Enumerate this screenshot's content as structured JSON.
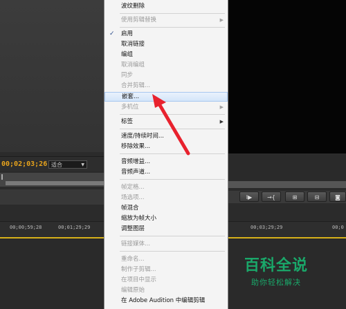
{
  "editor": {
    "timecode": "00;02;03;26",
    "fit_select": "适合",
    "ruler_left": [
      "00;00;59;28",
      "00;01;29;29"
    ],
    "ruler_right": [
      "00;03;29;29",
      "00;0"
    ],
    "buttons": [
      "I▶",
      "→{",
      "⊞",
      "⊟",
      "◙"
    ]
  },
  "menu": {
    "items": [
      {
        "label": "波纹删除",
        "disabled": false
      },
      {
        "label": "使用剪辑替换",
        "disabled": true,
        "submenu": true
      },
      {
        "label": "启用",
        "disabled": false,
        "checked": true
      },
      {
        "label": "取消链接",
        "disabled": false
      },
      {
        "label": "编组",
        "disabled": false
      },
      {
        "label": "取消编组",
        "disabled": true
      },
      {
        "label": "同步",
        "disabled": true
      },
      {
        "label": "合并剪辑...",
        "disabled": true
      },
      {
        "label": "嵌套...",
        "disabled": false,
        "highlighted": true
      },
      {
        "label": "多机位",
        "disabled": true,
        "submenu": true
      },
      {
        "label": "标签",
        "disabled": false,
        "submenu": true
      },
      {
        "label": "速度/持续时间...",
        "disabled": false
      },
      {
        "label": "移除效果...",
        "disabled": false
      },
      {
        "label": "音频增益...",
        "disabled": false
      },
      {
        "label": "音频声道...",
        "disabled": false
      },
      {
        "label": "帧定格...",
        "disabled": true
      },
      {
        "label": "场选项...",
        "disabled": true
      },
      {
        "label": "帧混合",
        "disabled": false
      },
      {
        "label": "缩放为帧大小",
        "disabled": false
      },
      {
        "label": "调整图层",
        "disabled": false
      },
      {
        "label": "链接媒体...",
        "disabled": true
      },
      {
        "label": "重命名...",
        "disabled": true
      },
      {
        "label": "制作子剪辑...",
        "disabled": true
      },
      {
        "label": "在项目中显示",
        "disabled": true
      },
      {
        "label": "编辑原始",
        "disabled": true
      },
      {
        "label": "在 Adobe Audition 中编辑剪辑",
        "disabled": false
      }
    ]
  },
  "watermark": {
    "title": "百科全说",
    "subtitle": "助你轻松解决"
  },
  "colors": {
    "timecode": "#e8a41c",
    "arrow": "#e8222e",
    "watermark": "#1aa86a",
    "highlight": "#d4e6f9"
  }
}
